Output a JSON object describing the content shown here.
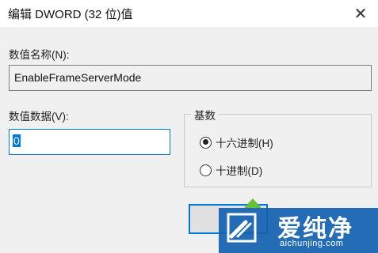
{
  "dialog": {
    "title": "编辑 DWORD (32 位)值",
    "close_glyph": "✕"
  },
  "value_name": {
    "label": "数值名称(N):",
    "value": "EnableFrameServerMode"
  },
  "value_data": {
    "label": "数值数据(V):",
    "value": "0"
  },
  "base": {
    "label": "基数",
    "options": [
      {
        "label": "十六进制(H)",
        "selected": true
      },
      {
        "label": "十进制(D)",
        "selected": false
      }
    ]
  },
  "ok_button": {
    "label": ""
  },
  "watermark": {
    "brand": "爱纯净",
    "url": "aichunjing.com",
    "bg_color": "#1462b0",
    "arrow_color": "#66c133"
  },
  "colors": {
    "accent": "#0078d7",
    "window_bg": "#f0f0f0"
  }
}
